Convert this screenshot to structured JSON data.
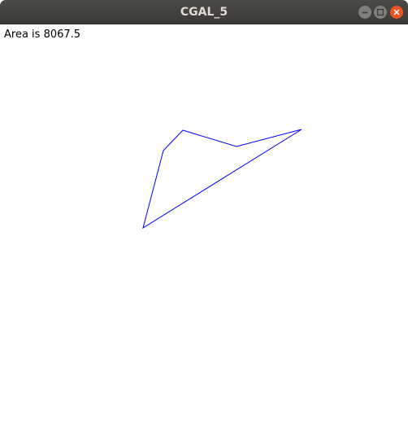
{
  "window": {
    "title": "CGAL_5"
  },
  "content": {
    "area_text": "Area is 8067.5",
    "polygon_color": "#0000ff"
  },
  "icons": {
    "minimize": "minimize-icon",
    "maximize": "maximize-icon",
    "close": "close-icon"
  }
}
